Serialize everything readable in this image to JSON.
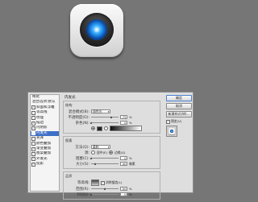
{
  "icon_preview": {
    "name": "camera-lens-app-icon"
  },
  "dialog": {
    "style_list": {
      "header_label": "样式",
      "blend_label": "混合选项:默认",
      "items": [
        {
          "label": "斜面和浮雕",
          "checked": true,
          "selected": false
        },
        {
          "label": "等高线",
          "checked": false,
          "selected": false
        },
        {
          "label": "纹理",
          "checked": false,
          "selected": false
        },
        {
          "label": "描边",
          "checked": true,
          "selected": false
        },
        {
          "label": "内阴影",
          "checked": true,
          "selected": false
        },
        {
          "label": "内发光",
          "checked": true,
          "selected": true
        },
        {
          "label": "光泽",
          "checked": false,
          "selected": false
        },
        {
          "label": "颜色叠加",
          "checked": false,
          "selected": false
        },
        {
          "label": "渐变叠加",
          "checked": true,
          "selected": false
        },
        {
          "label": "图案叠加",
          "checked": false,
          "selected": false
        },
        {
          "label": "外发光",
          "checked": true,
          "selected": false
        },
        {
          "label": "投影",
          "checked": true,
          "selected": false
        }
      ]
    },
    "panel": {
      "title": "内发光",
      "structure": {
        "label": "结构",
        "blend_mode_label": "混合模式(B):",
        "blend_mode_value": "线性光",
        "opacity_label": "不透明度(O):",
        "opacity_value": "75",
        "opacity_level": 0.75,
        "noise_label": "杂色(N):",
        "noise_value": "0",
        "noise_level": 0.0,
        "unit": "%"
      },
      "elements": {
        "label": "图素",
        "method_label": "方法(Q):",
        "method_value": "柔和",
        "source_label": "源:",
        "source_center": "居中(E)",
        "source_edge": "边缘(G)",
        "choke_label": "阻塞(C):",
        "choke_value": "0",
        "choke_level": 0.0,
        "size_label": "大小(S):",
        "size_value": "40",
        "size_level": 0.16,
        "pct": "%",
        "px": "像素"
      },
      "quality": {
        "label": "品质",
        "contour_label": "等高线:",
        "antialias_label": "消除锯齿(L)",
        "range_label": "范围(R):",
        "range_value": "50",
        "range_level": 0.5,
        "jitter_label": "抖动(J):",
        "jitter_value": "0",
        "jitter_level": 0.0
      }
    },
    "buttons": {
      "ok": "确定",
      "cancel": "取消",
      "new_style": "新建样式(W)...",
      "preview": "预览(V)",
      "preview_checked": true
    }
  }
}
